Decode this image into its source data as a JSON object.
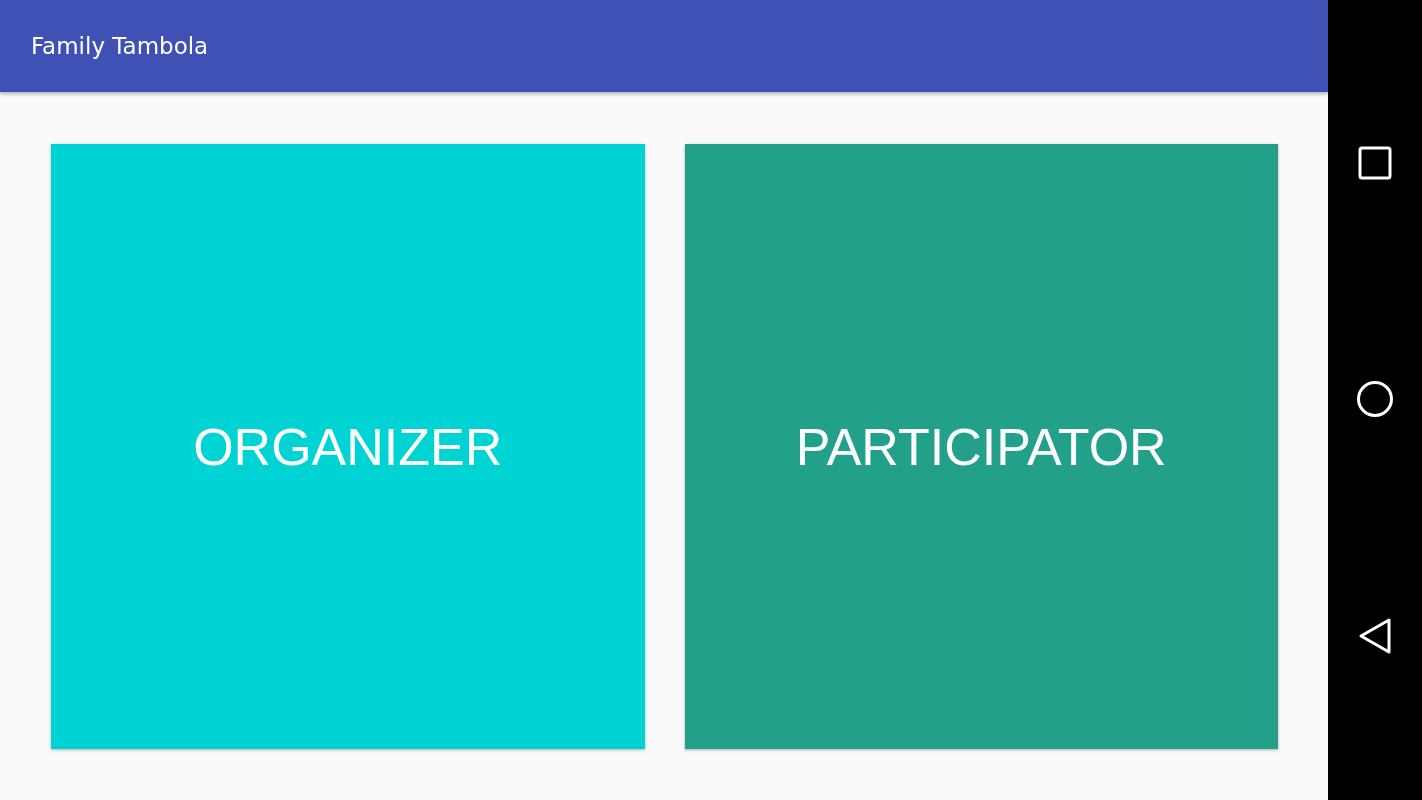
{
  "app_bar": {
    "title": "Family Tambola"
  },
  "options": [
    {
      "label": "ORGANIZER",
      "color": "#00d3d3"
    },
    {
      "label": "PARTICIPATOR",
      "color": "#22a08a"
    }
  ]
}
